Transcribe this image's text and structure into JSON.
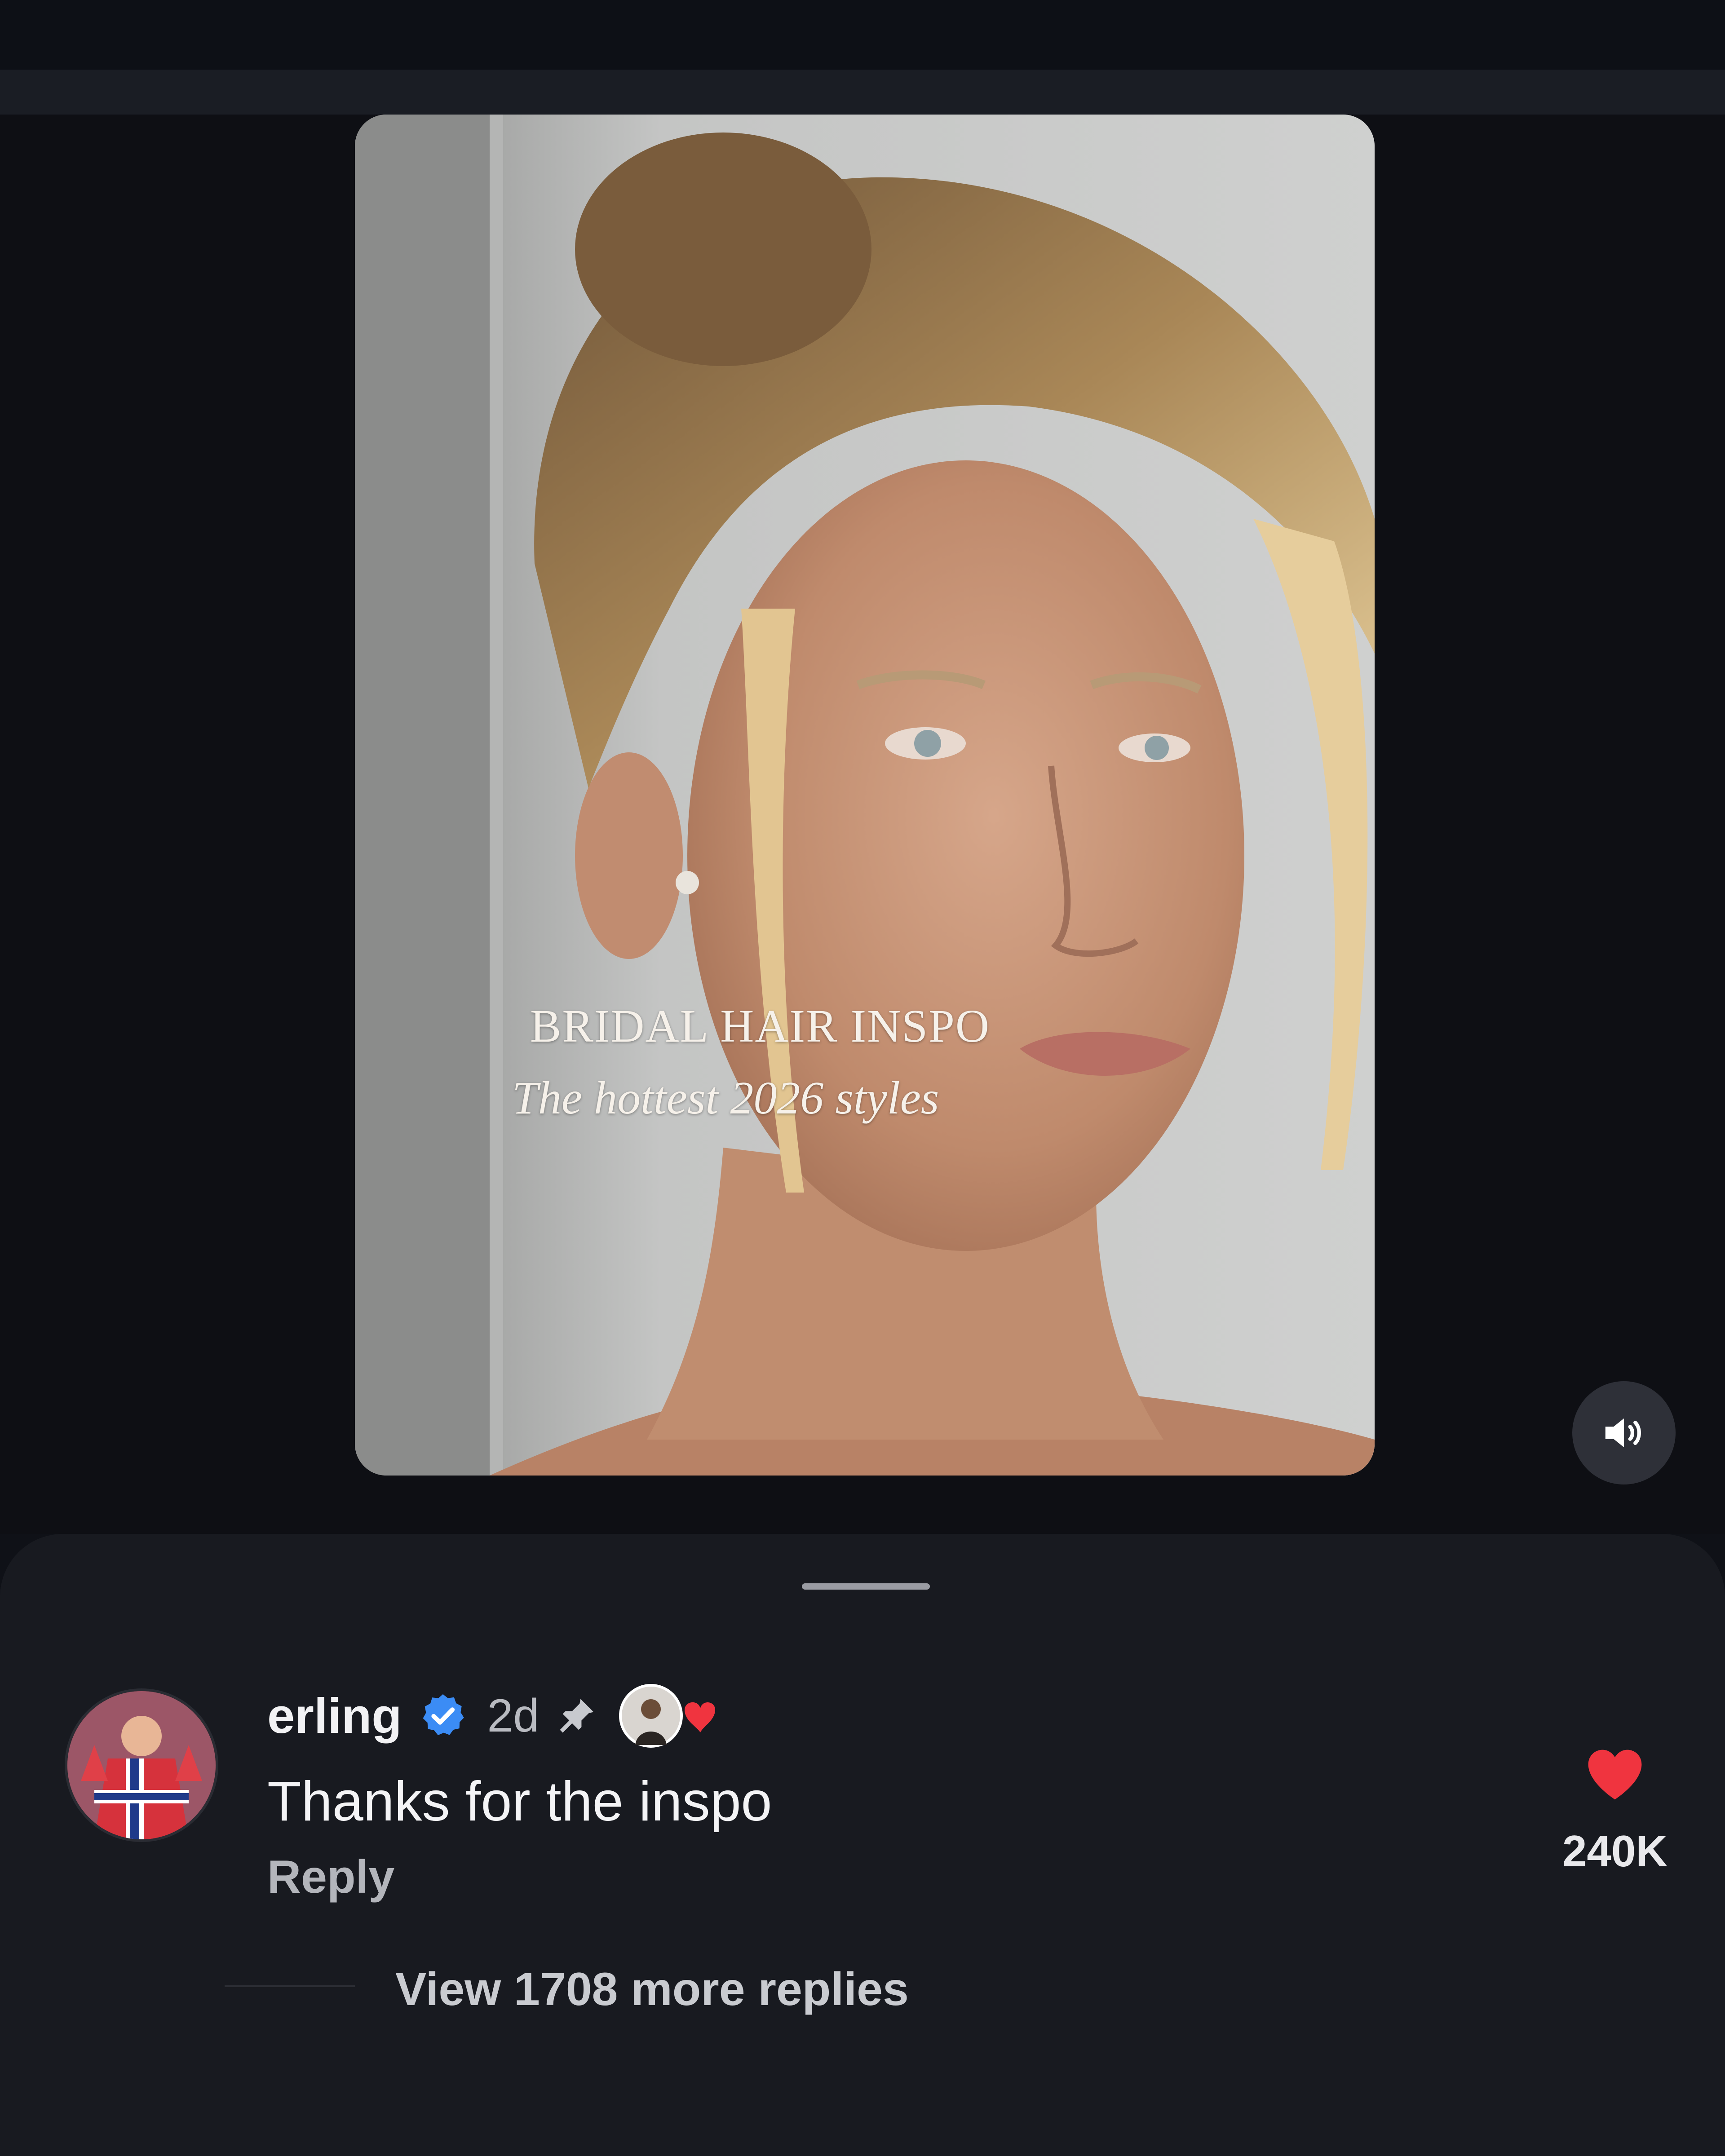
{
  "video": {
    "overlay_title": "BRIDAL HAIR INSPO",
    "overlay_subtitle": "The hottest 2026 styles",
    "sound_icon": "speaker-volume-icon"
  },
  "comment": {
    "username": "erling",
    "verified_icon": "verified-badge-icon",
    "time": "2d",
    "pin_icon": "pin-icon",
    "creator_liked_icon": "creator-liked-heart-icon",
    "text": "Thanks for the inspo",
    "reply_label": "Reply",
    "like_icon": "heart-icon",
    "like_count": "240K",
    "view_replies_label": "View 1708 more replies"
  },
  "colors": {
    "background": "#0f1117",
    "sheet": "#181a20",
    "like_red": "#f0343f",
    "verified_blue": "#3b8cf5"
  }
}
